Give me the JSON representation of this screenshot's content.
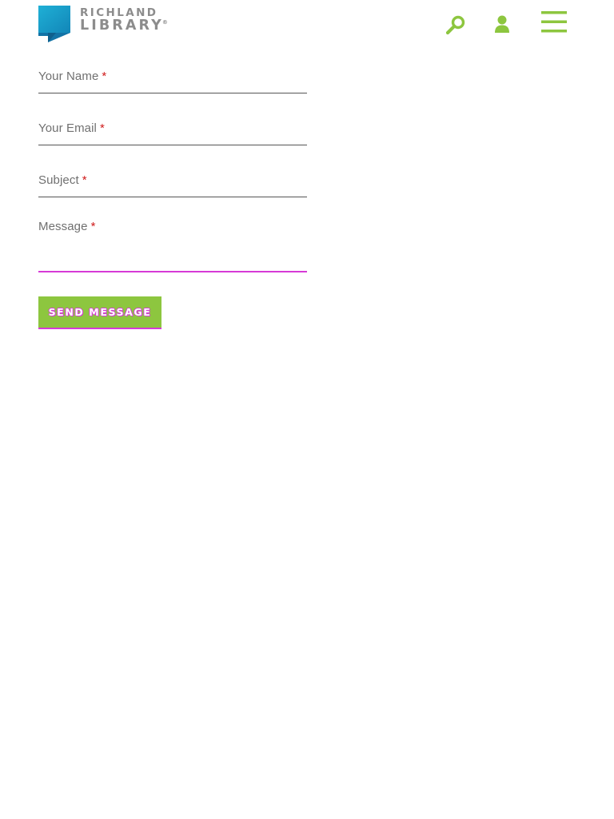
{
  "header": {
    "logo": {
      "line1": "RICHLAND",
      "line2": "LIBRARY",
      "registered": "®",
      "icon": "richland-library-logo-mark"
    },
    "search_icon": "search-icon",
    "account_icon": "user-icon",
    "menu_icon": "hamburger-menu-icon"
  },
  "form": {
    "required_mark": "*",
    "fields": [
      {
        "label": "Your Name",
        "value": "",
        "type": "text"
      },
      {
        "label": "Your Email",
        "value": "",
        "type": "email"
      },
      {
        "label": "Subject",
        "value": "",
        "type": "text"
      },
      {
        "label": "Message",
        "value": "",
        "type": "textarea"
      }
    ],
    "submit_label": "SEND MESSAGE"
  },
  "colors": {
    "brand_teal": "#1a9ec9",
    "accent_green": "#8dc63f",
    "focus_magenta": "#d63ad6",
    "required_red": "#cf1a1a",
    "label_gray": "#707070"
  }
}
